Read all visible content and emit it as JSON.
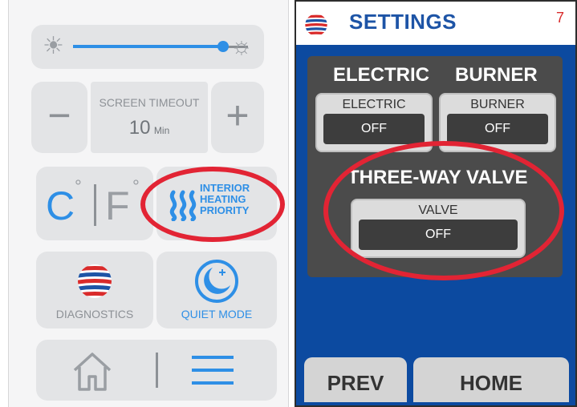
{
  "left_panel": {
    "brightness": {
      "level_percent": 86
    },
    "screen_timeout": {
      "label": "SCREEN TIMEOUT",
      "value": "10",
      "unit": "Min",
      "minus": "−",
      "plus": "+"
    },
    "units": {
      "celsius": "C",
      "fahrenheit": "F",
      "degree": "°"
    },
    "interior_heating": {
      "line1": "INTERIOR",
      "line2": "HEATING",
      "line3": "PRIORITY"
    },
    "diagnostics": {
      "label": "DIAGNOSTICS"
    },
    "quiet_mode": {
      "label": "QUIET MODE"
    },
    "icons": {
      "brightness_low": "☀",
      "brightness_high": "☼"
    }
  },
  "right_panel": {
    "header": {
      "title": "SETTINGS",
      "page_number": "7"
    },
    "electric_heading": "ELECTRIC",
    "burner_heading": "BURNER",
    "electric_box": {
      "label": "ELECTRIC",
      "value": "OFF"
    },
    "burner_box": {
      "label": "BURNER",
      "value": "OFF"
    },
    "valve_heading": "THREE-WAY VALVE",
    "valve_box": {
      "label": "VALVE",
      "value": "OFF"
    },
    "footer": {
      "prev": "PREV",
      "home": "HOME"
    }
  },
  "colors": {
    "accent_blue": "#2e8fe6",
    "highlight_red": "#e22434",
    "settings_blue": "#0c4aa0"
  }
}
